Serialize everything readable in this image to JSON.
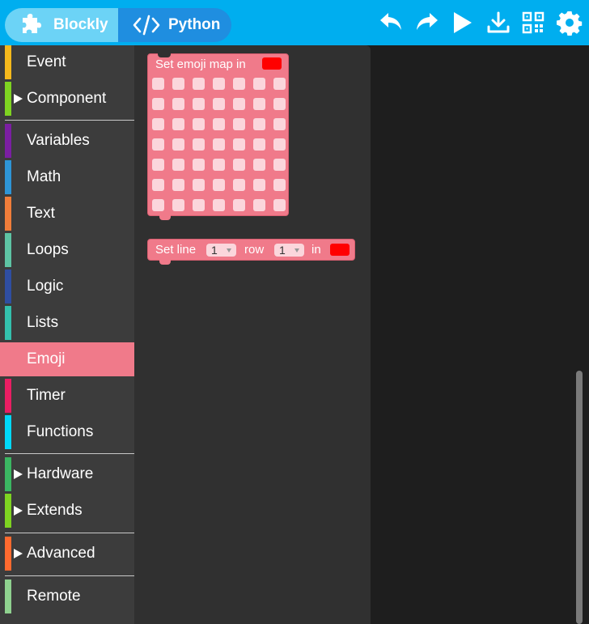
{
  "header": {
    "blockly_label": "Blockly",
    "python_label": "Python",
    "actions": [
      {
        "name": "undo-icon"
      },
      {
        "name": "redo-icon"
      },
      {
        "name": "run-icon"
      },
      {
        "name": "download-icon"
      },
      {
        "name": "qr-code-icon"
      },
      {
        "name": "settings-icon"
      }
    ],
    "colors": {
      "bar": "#00aeef",
      "blockly_tab": "#6cd3f6",
      "python_tab": "#1f8ee0"
    }
  },
  "sidebar": {
    "categories": [
      {
        "label": "Event",
        "color": "#f6b91c",
        "expandable": false
      },
      {
        "label": "Component",
        "color": "#7ed321",
        "expandable": true
      },
      {
        "label": "Variables",
        "color": "#7b1fa2",
        "expandable": false
      },
      {
        "label": "Math",
        "color": "#2e95d6",
        "expandable": false
      },
      {
        "label": "Text",
        "color": "#f07d3a",
        "expandable": false
      },
      {
        "label": "Loops",
        "color": "#5ec4a4",
        "expandable": false
      },
      {
        "label": "Logic",
        "color": "#2f4ea1",
        "expandable": false
      },
      {
        "label": "Lists",
        "color": "#33c0ad",
        "expandable": false
      },
      {
        "label": "Emoji",
        "color": "#f07a8a",
        "expandable": false,
        "selected": true
      },
      {
        "label": "Timer",
        "color": "#e91e63",
        "expandable": false
      },
      {
        "label": "Functions",
        "color": "#00d8f8",
        "expandable": false
      },
      {
        "label": "Hardware",
        "color": "#3bb662",
        "expandable": true
      },
      {
        "label": "Extends",
        "color": "#7ed321",
        "expandable": true
      },
      {
        "label": "Advanced",
        "color": "#ff6a2f",
        "expandable": true
      },
      {
        "label": "Remote",
        "color": "#8fd18f",
        "expandable": false
      }
    ]
  },
  "flyout": {
    "emoji_map_block": {
      "label": "Set emoji map in",
      "color": "#ff0000",
      "rows": 7,
      "cols": 7
    },
    "set_line_block": {
      "label_set": "Set line",
      "line_value": "1",
      "label_row": "row",
      "row_value": "1",
      "label_in": "in",
      "color": "#ff0000"
    }
  }
}
